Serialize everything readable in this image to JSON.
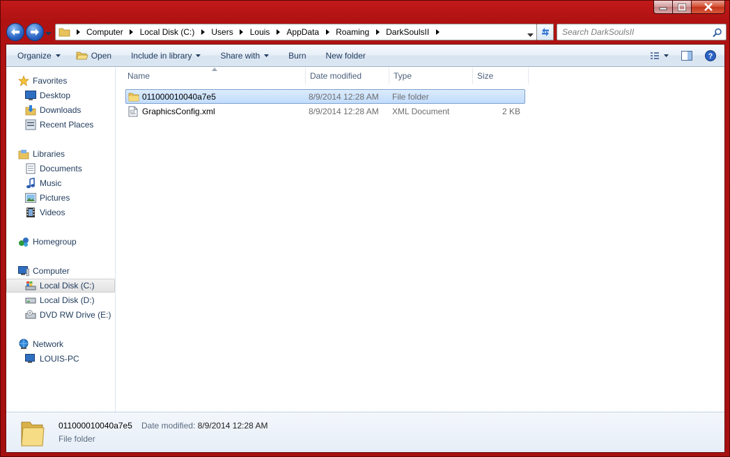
{
  "window": {
    "buttons": {
      "minimize_icon": "minimize-icon",
      "maximize_icon": "maximize-icon",
      "close_icon": "close-icon"
    }
  },
  "address": {
    "breadcrumbs": [
      "Computer",
      "Local Disk (C:)",
      "Users",
      "Louis",
      "AppData",
      "Roaming",
      "DarkSoulsII"
    ]
  },
  "search": {
    "placeholder": "Search DarkSoulsII"
  },
  "toolbar": {
    "organize": "Organize",
    "open": "Open",
    "include_in_library": "Include in library",
    "share_with": "Share with",
    "burn": "Burn",
    "new_folder": "New folder"
  },
  "navpane": {
    "favorites": {
      "label": "Favorites",
      "items": [
        "Desktop",
        "Downloads",
        "Recent Places"
      ]
    },
    "libraries": {
      "label": "Libraries",
      "items": [
        "Documents",
        "Music",
        "Pictures",
        "Videos"
      ]
    },
    "homegroup": {
      "label": "Homegroup"
    },
    "computer": {
      "label": "Computer",
      "items": [
        "Local Disk (C:)",
        "Local Disk (D:)",
        "DVD RW Drive (E:)"
      ],
      "selected": "Local Disk (C:)"
    },
    "network": {
      "label": "Network",
      "items": [
        "LOUIS-PC"
      ]
    }
  },
  "columns": {
    "name": "Name",
    "date_modified": "Date modified",
    "type": "Type",
    "size": "Size"
  },
  "files": [
    {
      "name": "011000010040a7e5",
      "date": "8/9/2014 12:28 AM",
      "type": "File folder",
      "size": "",
      "icon": "folder-icon",
      "selected": true
    },
    {
      "name": "GraphicsConfig.xml",
      "date": "8/9/2014 12:28 AM",
      "type": "XML Document",
      "size": "2 KB",
      "icon": "xml-file-icon",
      "selected": false
    }
  ],
  "details": {
    "name": "011000010040a7e5",
    "date_label": "Date modified:",
    "date_value": "8/9/2014 12:28 AM",
    "type": "File folder"
  },
  "colors": {
    "title_bar": "#b01212",
    "selection": "#c1dcfc",
    "toolbar_text": "#1e395b"
  }
}
